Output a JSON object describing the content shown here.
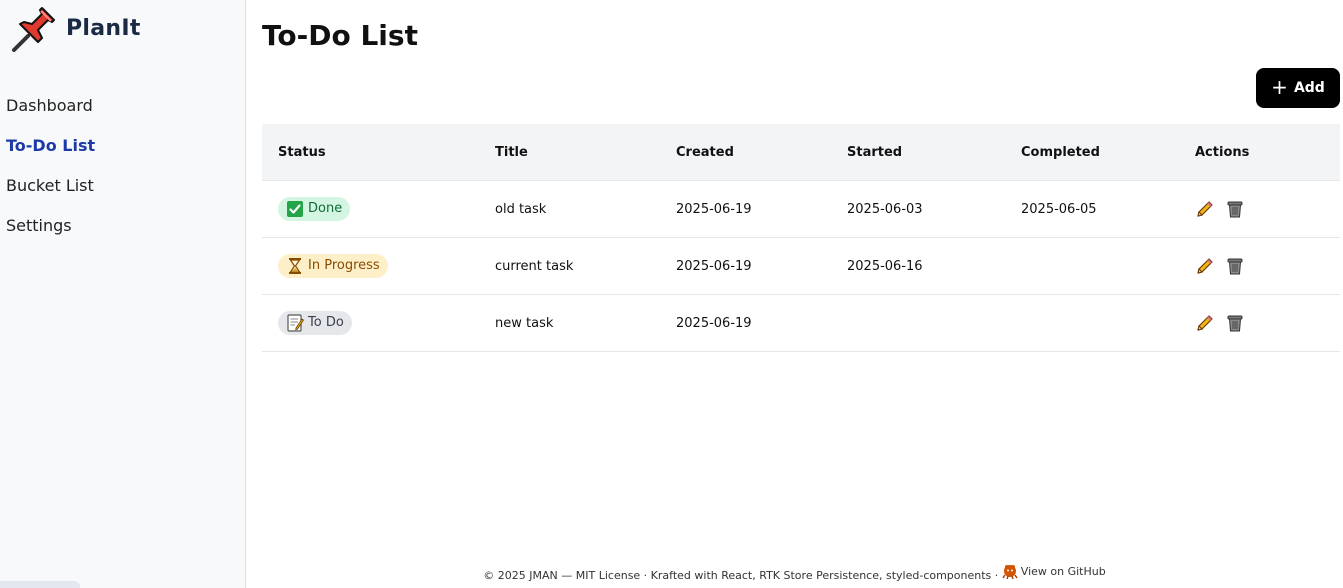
{
  "app": {
    "name": "PlanIt",
    "icon": "pushpin-icon"
  },
  "sidebar": {
    "items": [
      {
        "label": "Dashboard",
        "active": false
      },
      {
        "label": "To-Do List",
        "active": true
      },
      {
        "label": "Bucket List",
        "active": false
      },
      {
        "label": "Settings",
        "active": false
      }
    ]
  },
  "main": {
    "title": "To-Do List",
    "add_label": "Add",
    "add_icon": "plus-icon"
  },
  "table": {
    "headers": [
      "Status",
      "Title",
      "Created",
      "Started",
      "Completed",
      "Actions"
    ],
    "rows": [
      {
        "status": "Done",
        "status_icon": "check-box-icon",
        "title": "old task",
        "created": "2025-06-19",
        "started": "2025-06-03",
        "completed": "2025-06-05"
      },
      {
        "status": "In Progress",
        "status_icon": "hourglass-icon",
        "title": "current task",
        "created": "2025-06-19",
        "started": "2025-06-16",
        "completed": ""
      },
      {
        "status": "To Do",
        "status_icon": "memo-icon",
        "title": "new task",
        "created": "2025-06-19",
        "started": "",
        "completed": ""
      }
    ],
    "action_icons": [
      "pencil-icon",
      "trash-icon"
    ]
  },
  "footer": {
    "text": "© 2025 JMAN — MIT License · Krafted with React, RTK Store Persistence, styled-components ·",
    "github_label": "View on GitHub",
    "github_icon": "octocat-icon"
  },
  "colors": {
    "sidebar_bg": "#f8f9fb",
    "active_nav": "#1d3aa8",
    "brand_text": "#1b2a44",
    "add_button_bg": "#000000",
    "header_bg": "#f3f4f6",
    "badge_done_bg": "#d5f5e3",
    "badge_progress_bg": "#fdefc7",
    "badge_todo_bg": "#e5e7eb"
  }
}
